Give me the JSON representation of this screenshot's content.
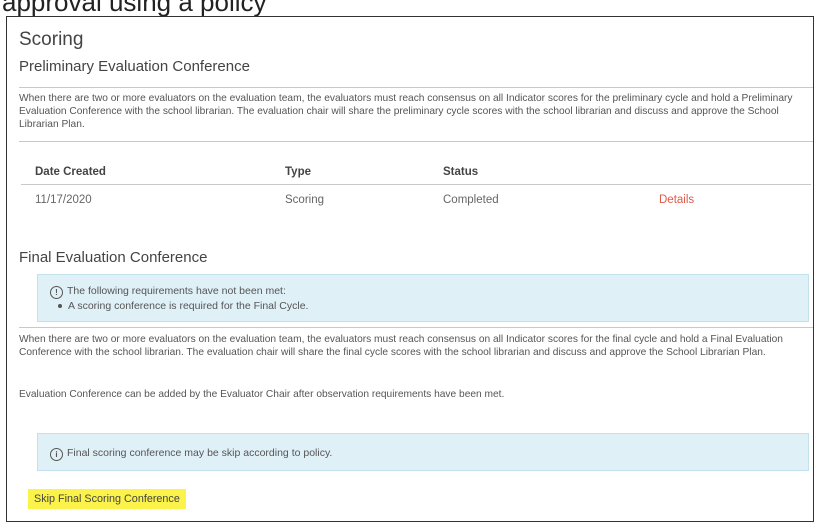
{
  "caption": "approval using a policy",
  "scoring": {
    "title": "Scoring",
    "prelim_title": "Preliminary Evaluation Conference",
    "prelim_paragraph": "When there are two or more evaluators on the evaluation team, the evaluators must reach consensus on all Indicator scores for the preliminary cycle and hold a Preliminary Evaluation Conference with the school librarian. The evaluation chair will share the preliminary cycle scores with the school librarian and discuss and approve the School Librarian Plan.",
    "table": {
      "headers": [
        "Date Created",
        "Type",
        "Status"
      ],
      "rows": [
        {
          "date": "11/17/2020",
          "type": "Scoring",
          "status": "Completed",
          "action": "Details"
        }
      ]
    }
  },
  "final": {
    "title": "Final Evaluation Conference",
    "requirements_alert": {
      "heading": "The following requirements have not been met:",
      "items": [
        "A scoring conference is required for the Final Cycle."
      ]
    },
    "final_paragraph": "When there are two or more evaluators on the evaluation team, the evaluators must reach consensus on all Indicator scores for the final cycle and hold a Final Evaluation Conference with the school librarian. The evaluation chair will share the final cycle scores with the school librarian and discuss and approve the School Librarian Plan.",
    "note": "Evaluation Conference can be added by the Evaluator Chair after observation requirements have been met.",
    "policy_alert": "Final scoring conference may be skip according to policy.",
    "skip_button": "Skip Final Scoring Conference"
  },
  "icons": {
    "alert_icon": "info-circle-icon"
  },
  "colors": {
    "details_link": "#e05a4a",
    "alert_bg": "#dff0f7",
    "highlight": "#fbf24a"
  }
}
